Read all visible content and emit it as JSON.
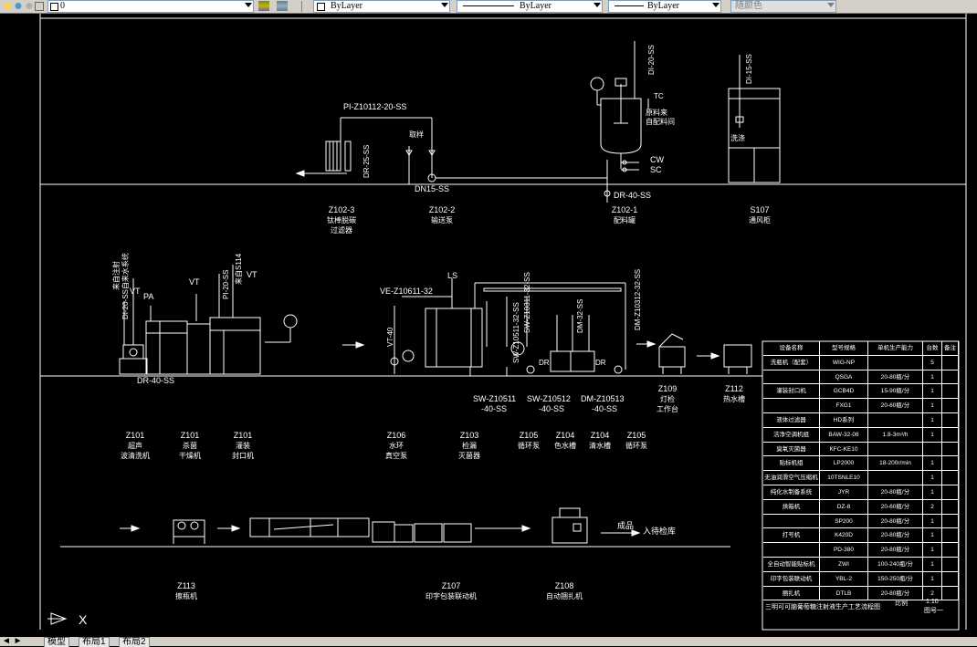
{
  "toolbar": {
    "layer_value": "0",
    "color_value": "ByLayer",
    "linetype_value": "ByLayer",
    "lineweight_value": "ByLayer",
    "plotstyle_value": "随颜色"
  },
  "tabs": [
    "模型",
    "布局1",
    "布局2"
  ],
  "axis_x_label": "X",
  "top_section": {
    "line_labels": [
      "PI-Z10112-20-SS",
      "DN15-SS",
      "DR-40-SS",
      "DI-20-SS",
      "DI-15-SS",
      "DR-25-SS"
    ],
    "notes": [
      "取样",
      "原料来",
      "自配料间",
      "CW",
      "SC",
      "洗涤",
      "TC",
      "LS"
    ],
    "equipment": [
      {
        "tag": "Z102-3",
        "name1": "钛棒脱碳",
        "name2": "过滤器"
      },
      {
        "tag": "Z102-2",
        "name1": "输送泵",
        "name2": ""
      },
      {
        "tag": "Z102-1",
        "name1": "配料罐",
        "name2": ""
      },
      {
        "tag": "S107",
        "name1": "通风柜",
        "name2": ""
      }
    ]
  },
  "middle_section": {
    "line_labels": [
      "DI-20-SS自来水系统",
      "来自注射",
      "PI-20-SS",
      "来自S114",
      "VE-Z10611-32",
      "VT-40",
      "SW-Z10311-32-SS",
      "SW-Z10511-32-SS",
      "DM-32-SS",
      "DM-Z10312-32-SS",
      "DR-40-SS",
      "SW-Z10511",
      "-40-SS",
      "SW-Z10512",
      "-40-SS",
      "DM-Z10513",
      "-40-SS",
      "DR",
      "DR"
    ],
    "markers": [
      "VT",
      "PA",
      "VT",
      "VT",
      "LS"
    ],
    "equipment": [
      {
        "tag": "Z101",
        "name1": "超声",
        "name2": "波清洗机"
      },
      {
        "tag": "Z101",
        "name1": "杀菌",
        "name2": "干燥机"
      },
      {
        "tag": "Z101",
        "name1": "灌装",
        "name2": "封口机"
      },
      {
        "tag": "Z106",
        "name1": "水环",
        "name2": "真空泵"
      },
      {
        "tag": "Z103",
        "name1": "检漏",
        "name2": "灭菌器"
      },
      {
        "tag": "Z105",
        "name1": "循环泵",
        "name2": ""
      },
      {
        "tag": "Z104",
        "name1": "色水槽",
        "name2": ""
      },
      {
        "tag": "Z104",
        "name1": "清水槽",
        "name2": ""
      },
      {
        "tag": "Z105",
        "name1": "循环泵",
        "name2": ""
      },
      {
        "tag": "Z109",
        "name1": "灯检",
        "name2": "工作台"
      },
      {
        "tag": "Z112",
        "name1": "热水槽",
        "name2": ""
      }
    ]
  },
  "bottom_section": {
    "product_label": "成品",
    "warehouse_label": "入待检库",
    "equipment": [
      {
        "tag": "Z113",
        "name1": "擦瓶机",
        "name2": ""
      },
      {
        "tag": "Z107",
        "name1": "印字包装联动机",
        "name2": ""
      },
      {
        "tag": "Z108",
        "name1": "自动捆扎机",
        "name2": ""
      }
    ]
  },
  "spec_table": {
    "headers": [
      "设备名称",
      "型号规格",
      "单机生产能力",
      "台数",
      "备注"
    ],
    "rows": [
      [
        "洗瓶机（配套）",
        "WIG-NP",
        "",
        "5",
        ""
      ],
      [
        "",
        "QSGA",
        "20-80瓶/分",
        "1",
        ""
      ],
      [
        "灌装封口机",
        "GCB4D",
        "15-90瓶/分",
        "1",
        ""
      ],
      [
        "",
        "FXG1",
        "20-60瓶/分",
        "1",
        ""
      ],
      [
        "液体过滤器",
        "HD系列",
        "",
        "1",
        ""
      ],
      [
        "洁净空调机组",
        "BAW-32-08",
        "1.8-3m³/h",
        "1",
        ""
      ],
      [
        "臭氧灭菌器",
        "KFC-KE10",
        "",
        "",
        ""
      ],
      [
        "贴标机组",
        "LP2000",
        "18-200r/min",
        "1",
        ""
      ],
      [
        "无油润滑空气压缩机",
        "10TSNLE10",
        "",
        "1",
        ""
      ],
      [
        "纯化水制备系统",
        "JYR",
        "20-80瓶/分",
        "1",
        ""
      ],
      [
        "烘箱机",
        "DZ-8",
        "20-60瓶/分",
        "2",
        ""
      ],
      [
        "",
        "SP200",
        "20-80瓶/分",
        "1",
        ""
      ],
      [
        "打号机",
        "K420D",
        "20-80瓶/分",
        "1",
        ""
      ],
      [
        "",
        "PD-380",
        "20-80瓶/分",
        "1",
        ""
      ],
      [
        "全自动智能贴标机",
        "ZWI",
        "100-240瓶/分",
        "1",
        ""
      ],
      [
        "印字包装联动机",
        "YBL-2",
        "150-250瓶/分",
        "1",
        ""
      ],
      [
        "捆扎机",
        "DTLB",
        "20-80瓶/分",
        "2",
        ""
      ]
    ],
    "footer_left": "三明可可脑葡萄糖注射液生产工艺流程图",
    "footer_mid": "比例",
    "footer_scale": "1:10",
    "footer_sheet": "图号一"
  }
}
